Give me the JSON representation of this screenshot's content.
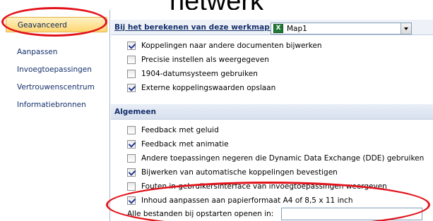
{
  "heading": "netwerk",
  "sidebar": {
    "items": [
      {
        "label": "Geavanceerd",
        "selected": true
      },
      {
        "label": "Aanpassen"
      },
      {
        "label": "Invoegtoepassingen"
      },
      {
        "label": "Vertrouwenscentrum"
      },
      {
        "label": "Informatiebronnen"
      }
    ]
  },
  "workbook_section": {
    "label": "Bij het berekenen van deze werkmap:",
    "combo_value": "Map1",
    "combo_icon": "excel-workbook-icon",
    "options": [
      {
        "label": "Koppelingen naar andere documenten bijwerken",
        "checked": true
      },
      {
        "label": "Precisie instellen als weergegeven",
        "checked": false
      },
      {
        "label": "1904-datumsysteem gebruiken",
        "checked": false
      },
      {
        "label": "Externe koppelingswaarden opslaan",
        "checked": true
      }
    ]
  },
  "general_section": {
    "label": "Algemeen",
    "options": [
      {
        "label": "Feedback met geluid",
        "checked": false
      },
      {
        "label": "Feedback met animatie",
        "checked": true
      },
      {
        "label": "Andere toepassingen negeren die Dynamic Data Exchange (DDE) gebruiken",
        "checked": false
      },
      {
        "label": "Bijwerken van automatische koppelingen bevestigen",
        "checked": true
      },
      {
        "label": "Fouten in gebruikersinterface van invoegtoepassingen weergeven",
        "checked": false
      },
      {
        "label": "Inhoud aanpassen aan papierformaat A4 of 8,5 x 11 inch",
        "checked": true
      }
    ],
    "open_files_label": "Alle bestanden bij opstarten openen in:",
    "open_files_value": ""
  },
  "annotation_color": "#e3131c"
}
